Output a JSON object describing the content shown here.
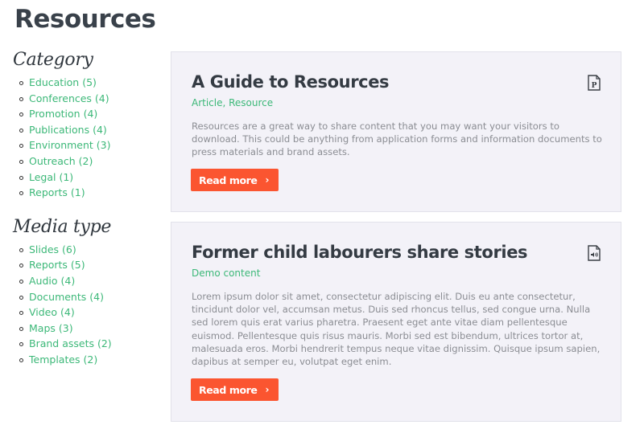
{
  "page": {
    "title": "Resources"
  },
  "sidebar": {
    "category": {
      "heading": "Category",
      "items": [
        {
          "label": "Education (5)"
        },
        {
          "label": "Conferences (4)"
        },
        {
          "label": "Promotion (4)"
        },
        {
          "label": "Publications (4)"
        },
        {
          "label": "Environment (3)"
        },
        {
          "label": "Outreach (2)"
        },
        {
          "label": "Legal (1)"
        },
        {
          "label": "Reports (1)"
        }
      ]
    },
    "media": {
      "heading": "Media type",
      "items": [
        {
          "label": "Slides (6)"
        },
        {
          "label": "Reports (5)"
        },
        {
          "label": "Audio (4)"
        },
        {
          "label": "Documents (4)"
        },
        {
          "label": "Video (4)"
        },
        {
          "label": "Maps (3)"
        },
        {
          "label": "Brand assets (2)"
        },
        {
          "label": "Templates (2)"
        }
      ]
    }
  },
  "cards": [
    {
      "title": "A Guide to Resources",
      "tags": "Article, Resource",
      "icon": "pdf-file-icon",
      "icon_glyph": "P",
      "text": "Resources are a great way to share content that you may want your visitors to download. This could be anything from application forms and information documents to press materials and brand assets.",
      "button": "Read more",
      "chevron": "›"
    },
    {
      "title": "Former child labourers share stories",
      "tags": "Demo content",
      "icon": "audio-file-icon",
      "text": "Lorem ipsum dolor sit amet, consectetur adipiscing elit. Duis eu ante consectetur, tincidunt dolor vel, accumsan metus. Duis sed rhoncus tellus, sed congue urna. Nulla sed lorem quis erat varius pharetra. Praesent eget ante vitae diam pellentesque euismod. Pellentesque quis risus mauris. Morbi sed est bibendum, ultrices tortor at, malesuada eros. Morbi hendrerit tempus neque vitae dignissim. Quisque ipsum sapien, dapibus at semper eu, volutpat eget enim.",
      "button": "Read more",
      "chevron": "›"
    }
  ],
  "colors": {
    "accent_green": "#3cb878",
    "button_orange": "#fb5530",
    "card_bg": "#f3f2f8",
    "heading": "#39414a"
  }
}
